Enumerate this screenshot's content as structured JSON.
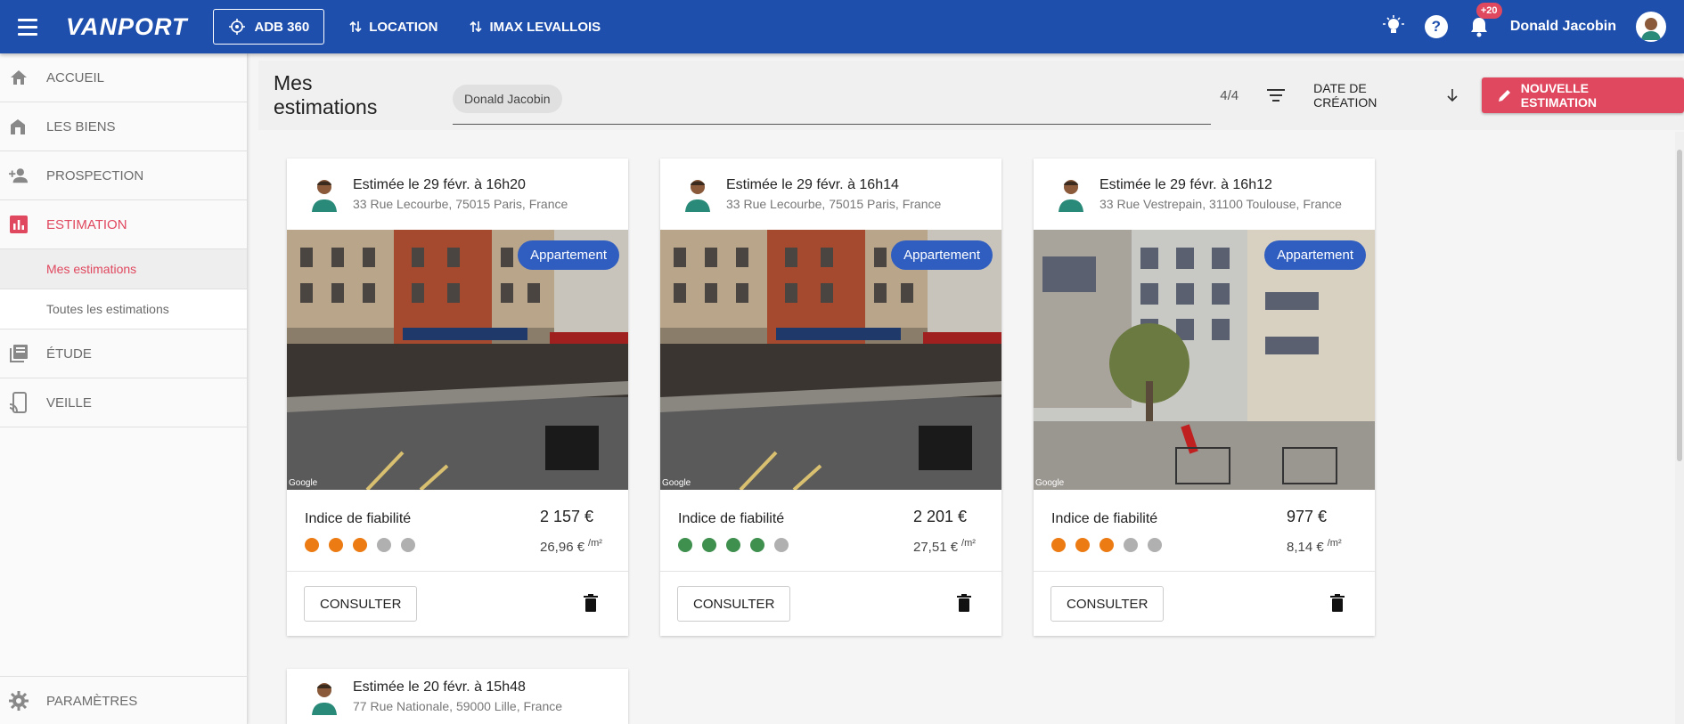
{
  "topbar": {
    "logo": "VANPORT",
    "adb_label": "ADB 360",
    "location_label": "LOCATION",
    "imax_label": "IMAX LEVALLOIS",
    "notif_count": "+20",
    "user_name": "Donald Jacobin"
  },
  "sidebar": {
    "items": [
      {
        "label": "ACCUEIL",
        "icon": "home-icon"
      },
      {
        "label": "LES BIENS",
        "icon": "property-icon"
      },
      {
        "label": "PROSPECTION",
        "icon": "add-person-icon"
      },
      {
        "label": "ESTIMATION",
        "icon": "chart-icon"
      },
      {
        "label": "ÉTUDE",
        "icon": "library-icon"
      },
      {
        "label": "VEILLE",
        "icon": "cast-icon"
      }
    ],
    "sub_items": [
      "Mes estimations",
      "Toutes les estimations"
    ],
    "settings_label": "PARAMÈTRES"
  },
  "header": {
    "title": "Mes estimations",
    "chip": "Donald Jacobin",
    "count": "4/4",
    "sort_label": "DATE DE CRÉATION",
    "new_button": "NOUVELLE ESTIMATION"
  },
  "cards": [
    {
      "date": "Estimée le 29 févr. à 16h20",
      "address": "33 Rue Lecourbe, 75015 Paris, France",
      "type": "Appartement",
      "reliability_label": "Indice de fiabilité",
      "reliability_dots": [
        "#ec7b13",
        "#ec7b13",
        "#ec7b13",
        "#b0b0b0",
        "#b0b0b0"
      ],
      "price": "2 157 €",
      "price_m2": "26,96 €",
      "unit": "/m²",
      "consult": "CONSULTER",
      "google": "Google"
    },
    {
      "date": "Estimée le 29 févr. à 16h14",
      "address": "33 Rue Lecourbe, 75015 Paris, France",
      "type": "Appartement",
      "reliability_label": "Indice de fiabilité",
      "reliability_dots": [
        "#3f8f4f",
        "#3f8f4f",
        "#3f8f4f",
        "#3f8f4f",
        "#b0b0b0"
      ],
      "price": "2 201 €",
      "price_m2": "27,51 €",
      "unit": "/m²",
      "consult": "CONSULTER",
      "google": "Google"
    },
    {
      "date": "Estimée le 29 févr. à 16h12",
      "address": "33 Rue Vestrepain, 31100 Toulouse, France",
      "type": "Appartement",
      "reliability_label": "Indice de fiabilité",
      "reliability_dots": [
        "#ec7b13",
        "#ec7b13",
        "#ec7b13",
        "#b0b0b0",
        "#b0b0b0"
      ],
      "price": "977 €",
      "price_m2": "8,14 €",
      "unit": "/m²",
      "consult": "CONSULTER",
      "google": "Google"
    },
    {
      "date": "Estimée le 20 févr. à 15h48",
      "address": "77 Rue Nationale, 59000 Lille, France"
    }
  ]
}
